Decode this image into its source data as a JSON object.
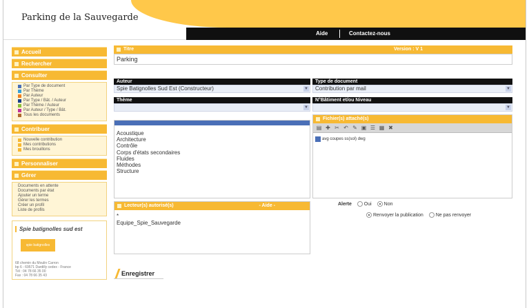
{
  "header": {
    "title": "Parking de la Sauvegarde",
    "nav": {
      "aide": "Aide",
      "contact": "Contactez-nous"
    }
  },
  "sidebar": {
    "accueil": "Accueil",
    "rechercher": "Rechercher",
    "consulter": {
      "label": "Consulter",
      "items": [
        {
          "label": "Par Type de document",
          "color": "#4a6fb7"
        },
        {
          "label": "Par Thème",
          "color": "#3aa0d8"
        },
        {
          "label": "Par Auteur",
          "color": "#f08020"
        },
        {
          "label": "Par Type / Bât. / Auteur",
          "color": "#1a3f8c"
        },
        {
          "label": "Par Thème / Auteur",
          "color": "#8dbf3a"
        },
        {
          "label": "Par Auteur / Type / Bât.",
          "color": "#c0309a"
        },
        {
          "label": "Tous les documents",
          "color": "#b06a30"
        }
      ]
    },
    "contribuer": {
      "label": "Contribuer",
      "items": [
        {
          "label": "Nouvelle contribution",
          "color": "#f7b933"
        },
        {
          "label": "Mes contributions",
          "color": "#f7b933"
        },
        {
          "label": "Mes brouillons",
          "color": "#f7b933"
        }
      ]
    },
    "personnaliser": "Personnaliser",
    "gerer": {
      "label": "Gérer",
      "items": [
        "Documents en attente",
        "Documents par état",
        "Ajouter un terme",
        "Gérer les termes",
        "Créer un profil",
        "Liste de profils"
      ]
    },
    "company": {
      "name": "Spie batignolles sud est",
      "logo_text": "spie batignolles",
      "address": [
        "68 chemin du Moulin Carron",
        "bp 6 - 69571 Dardilly cedex - France",
        "Tél : 04 78 66 35 00",
        "Fax : 04 78 66 35 43"
      ]
    }
  },
  "form": {
    "titre_label": "Titre",
    "version": "Version : V 1",
    "titre_value": "Parking",
    "auteur_label": "Auteur",
    "auteur_value": "Spie Batignolles Sud Est (Constructeur)",
    "type_label": "Type de document",
    "type_value": "Contribution par mail",
    "theme_label": "Thème",
    "batiment_label": "N°Bâtiment et/ou Niveau",
    "theme_options": [
      "Acoustique",
      "Architecture",
      "Contrôle",
      "Corps d'états secondaires",
      "Fluides",
      "Méthodes",
      "Structure"
    ],
    "fichiers_label": "Fichier(s) attaché(s)",
    "fichier_name": "avg coupes ss(sol) dwg",
    "lecteurs_label": "Lecteur(s) autorisé(s)",
    "lecteurs_aide": "- Aide -",
    "lecteurs_values": [
      "*",
      "Equipe_Spie_Sauvegarde"
    ],
    "alerte_label": "Alerte",
    "alerte_oui": "Oui",
    "alerte_non": "Non",
    "renvoyer": "Renvoyer la publication",
    "ne_pas_renvoyer": "Ne pas renvoyer",
    "enregistrer": "Enregistrer"
  }
}
